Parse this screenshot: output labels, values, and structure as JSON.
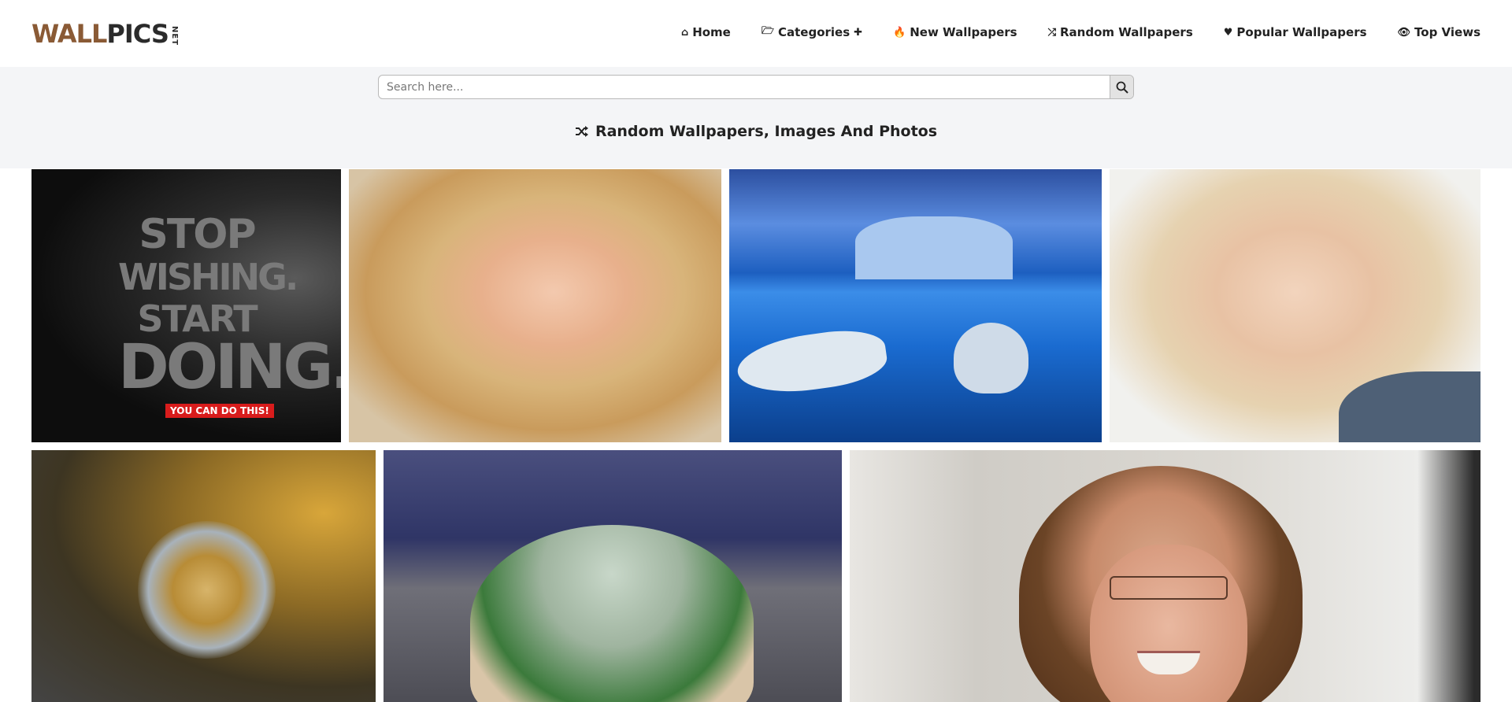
{
  "header": {
    "logo": {
      "main_left": "WALL",
      "main_right": "PICS",
      "net": "NET"
    },
    "nav": [
      {
        "icon": "home-icon",
        "glyph": "⌂",
        "label": "Home"
      },
      {
        "icon": "folder-open-icon",
        "glyph": "🗁",
        "label": "Categories",
        "suffix": "✚"
      },
      {
        "icon": "fire-icon",
        "glyph": "🔥",
        "label": "New Wallpapers"
      },
      {
        "icon": "random-icon",
        "glyph": "⤮",
        "label": "Random Wallpapers"
      },
      {
        "icon": "heart-icon",
        "glyph": "♥",
        "label": "Popular Wallpapers"
      },
      {
        "icon": "eye-icon",
        "glyph": "👁",
        "label": "Top Views"
      }
    ]
  },
  "search": {
    "placeholder": "Search here..."
  },
  "page": {
    "heading": "Random Wallpapers, Images And Photos",
    "heading_icon": "random-icon"
  },
  "thumbs": {
    "t1": {
      "motto_lines": [
        "STOP",
        "WISHING.",
        "START",
        "DOING."
      ],
      "tag": "YOU CAN DO THIS!"
    }
  },
  "colors": {
    "logo_accent": "#8a5a35",
    "band_bg": "#f4f5f7",
    "text": "#222222",
    "tag_red": "#d81c1c"
  }
}
